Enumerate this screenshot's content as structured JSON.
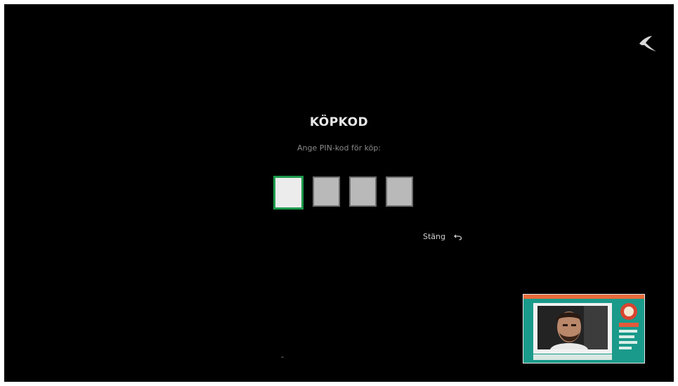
{
  "dialog": {
    "title": "KÖPKOD",
    "subtitle": "Ange PIN-kod för köp:"
  },
  "pin": {
    "length": 4,
    "active_index": 0
  },
  "close": {
    "label": "Stäng",
    "icon": "back-arrow-icon"
  },
  "brand": {
    "icon": "telia-pebble-icon"
  },
  "pip": {
    "icon": "picture-in-picture-video"
  },
  "colors": {
    "background": "#000000",
    "accent": "#1d9a4c",
    "pip_bg": "#1a9a8a"
  }
}
